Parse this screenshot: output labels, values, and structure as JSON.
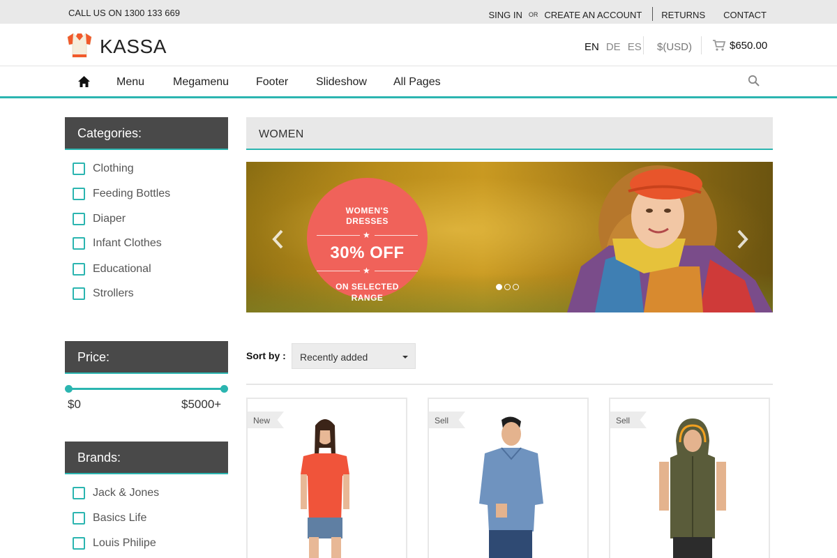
{
  "topbar": {
    "phone": "CALL US ON 1300 133 669",
    "sign_in": "SING IN",
    "or": "OR",
    "create_account": "CREATE AN ACCOUNT",
    "returns": "RETURNS",
    "contact": "CONTACT"
  },
  "header": {
    "logo_text": "KASSA",
    "logo_icon": "shirt-icon",
    "languages": [
      "EN",
      "DE",
      "ES"
    ],
    "active_language": "EN",
    "currency": "$(USD)",
    "cart_icon": "cart-icon",
    "cart_total": "$650.00"
  },
  "nav": {
    "home_icon": "home-icon",
    "items": [
      "Menu",
      "Megamenu",
      "Footer",
      "Slideshow",
      "All Pages"
    ],
    "search_icon": "search-icon"
  },
  "sidebar": {
    "categories_title": "Categories:",
    "categories": [
      "Clothing",
      "Feeding Bottles",
      "Diaper",
      "Infant Clothes",
      "Educational",
      "Strollers"
    ],
    "price_title": "Price:",
    "price_min": "$0",
    "price_max": "$5000+",
    "brands_title": "Brands:",
    "brands": [
      "Jack & Jones",
      "Basics Life",
      "Louis Philipe"
    ]
  },
  "main": {
    "section_title": "WOMEN",
    "banner": {
      "line1": "WOMEN'S",
      "line2": "DRESSES",
      "headline": "30% OFF",
      "line3": "ON SELECTED",
      "line4": "RANGE",
      "slide_count": 3,
      "active_slide": 1
    },
    "sort_label": "Sort by :",
    "sort_value": "Recently added",
    "products": [
      {
        "tag": "New"
      },
      {
        "tag": "Sell"
      },
      {
        "tag": "Sell"
      }
    ]
  },
  "colors": {
    "accent": "#2bb5b0",
    "sidebar_header": "#494949",
    "promo": "#f0625a"
  }
}
